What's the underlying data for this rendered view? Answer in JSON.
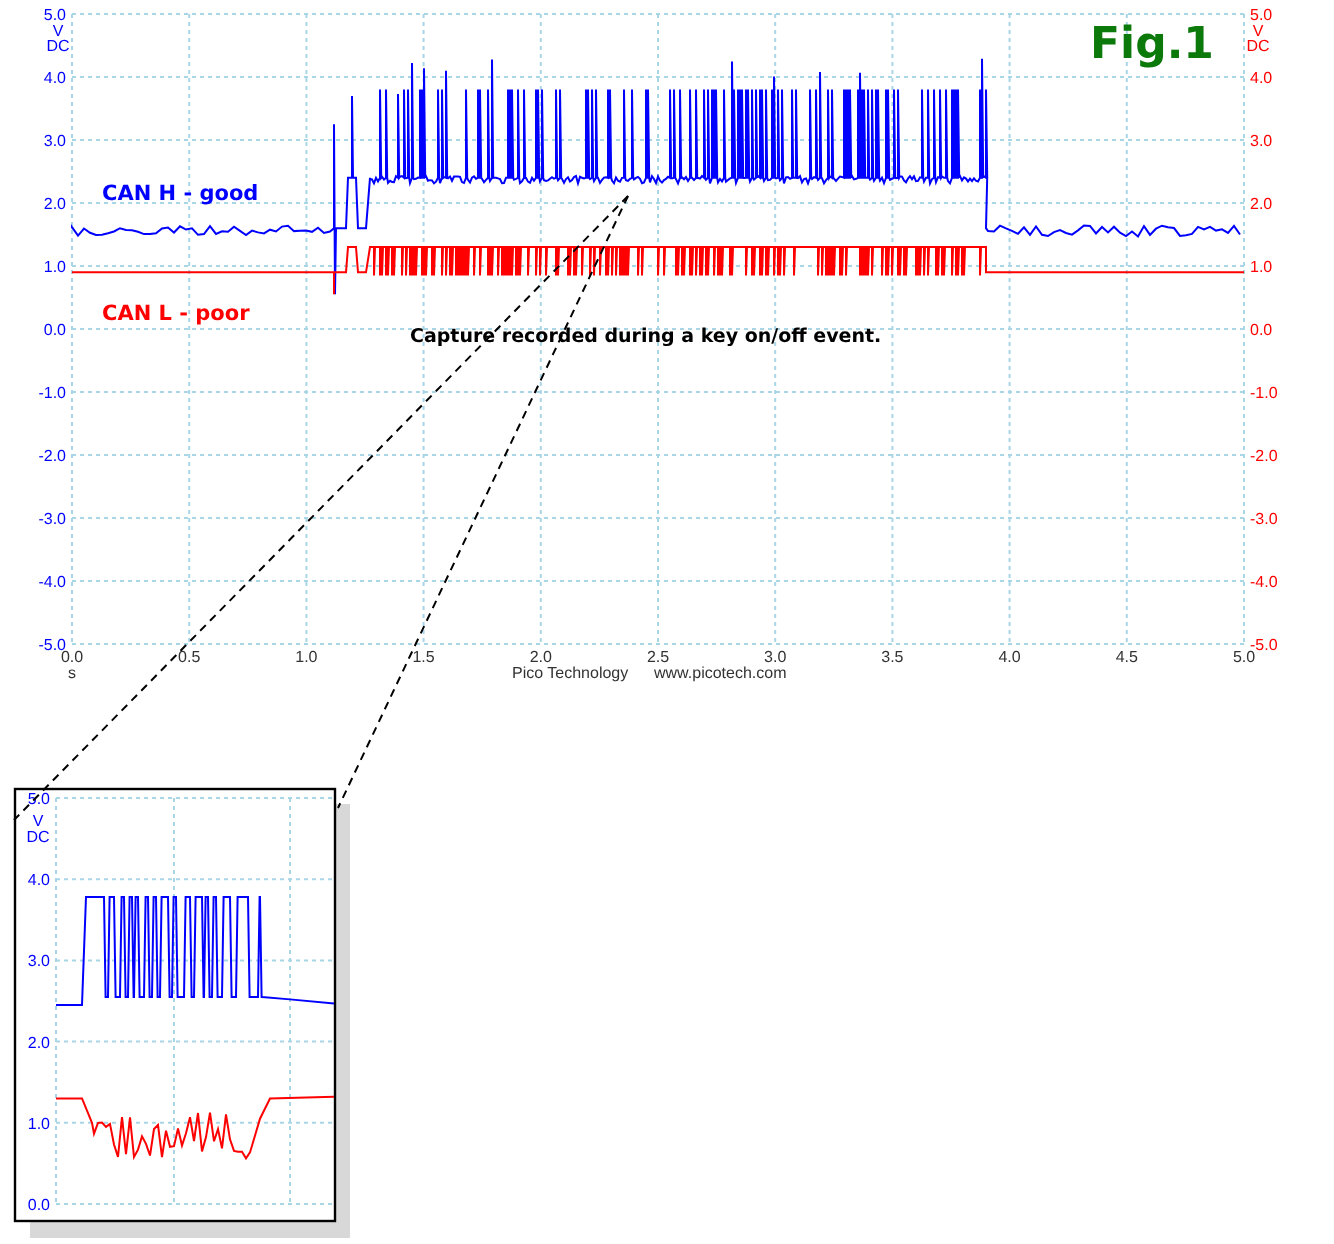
{
  "figure_label": "Fig.1",
  "scope": {
    "left_y_ticks": [
      "5.0",
      "4.0",
      "3.0",
      "2.0",
      "1.0",
      "0.0",
      "-1.0",
      "-2.0",
      "-3.0",
      "-4.0",
      "-5.0"
    ],
    "left_y_unit": [
      "V",
      "DC"
    ],
    "right_y_ticks": [
      "5.0",
      "4.0",
      "3.0",
      "2.0",
      "1.0",
      "0.0",
      "-1.0",
      "-2.0",
      "-3.0",
      "-4.0",
      "-5.0"
    ],
    "right_y_unit": [
      "V",
      "DC"
    ],
    "x_ticks": [
      "0.0",
      "0.5",
      "1.0",
      "1.5",
      "2.0",
      "2.5",
      "3.0",
      "3.5",
      "4.0",
      "4.5",
      "5.0"
    ],
    "x_unit": "s",
    "footer": [
      "Pico Technology",
      "www.picotech.com"
    ],
    "caption": "Capture recorded during a key on/off event.",
    "traces": [
      {
        "label": "CAN H - good",
        "color": "#0000ff"
      },
      {
        "label": "CAN L - poor",
        "color": "#ff0000"
      }
    ]
  },
  "inset": {
    "y_ticks": [
      "5.0",
      "4.0",
      "3.0",
      "2.0",
      "1.0",
      "0.0"
    ],
    "y_unit": [
      "V",
      "DC"
    ]
  }
}
